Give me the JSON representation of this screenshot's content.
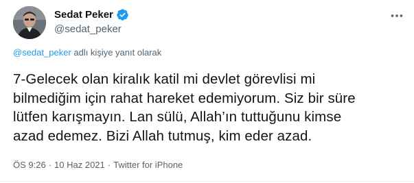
{
  "user": {
    "display_name": "Sedat Peker",
    "handle": "@sedat_peker",
    "verified": true,
    "avatar_icon": "profile-photo"
  },
  "header": {
    "more_icon": "more-horizontal-icon"
  },
  "reply_context": {
    "mention": "@sedat_peker",
    "suffix": " adlı kişiye yanıt olarak"
  },
  "tweet": {
    "text": "7-Gelecek olan kiralık katil mi devlet görevlisi mi\nbilmediğim için rahat hareket edemiyorum. Siz bir süre\nlütfen karışmayın. Lan sülü, Allah’ın tuttuğunu kimse\nazad edemez. Bizi Allah tutmuş, kim eder azad."
  },
  "meta": {
    "time": "ÖS 9:26",
    "separator1": "·",
    "date": "10 Haz 2021",
    "separator2": "·",
    "source": "Twitter for iPhone"
  },
  "colors": {
    "accent": "#1d9bf0",
    "secondary_text": "#536471",
    "primary_text": "#0f1419"
  }
}
